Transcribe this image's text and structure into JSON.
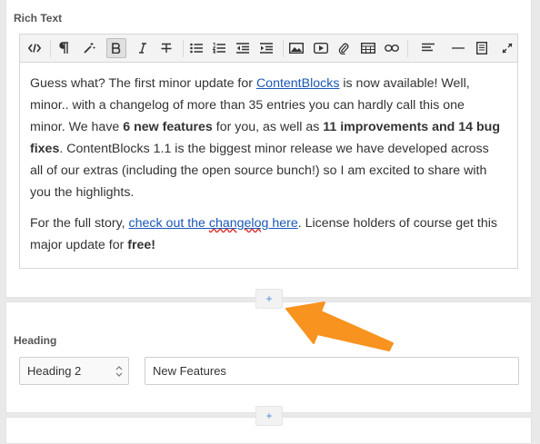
{
  "rich_text": {
    "label": "Rich Text",
    "toolbar_icons": [
      "code-view",
      "paragraph-format",
      "magic-wand",
      "bold",
      "italic",
      "strikethrough",
      "bullet-list",
      "numbered-list",
      "outdent",
      "indent",
      "image",
      "video",
      "attachment",
      "table",
      "link",
      "align",
      "horizontal-rule",
      "document",
      "fullscreen"
    ],
    "p1": {
      "t1": "Guess what? The first minor update for ",
      "link1": "ContentBlocks",
      "t2": " is now available! Well, minor.. with a changelog of more than 35 entries you can hardly call this one minor. We have ",
      "b1": "6 new features",
      "t3": " for you, as well as ",
      "b2": "11 improvements and 14 bug fixes",
      "t4": ". ContentBlocks 1.1 is the biggest minor release we have developed across all of our extras (including the open source bunch!) so I am excited to share with you the highlights."
    },
    "p2": {
      "t1": "For the full story, ",
      "link_a": "check out the ",
      "link_b": "changelog",
      "link_c": " here",
      "t2": ". License holders of course get this major update for ",
      "b1": "free!"
    }
  },
  "add_button_label": "+",
  "heading": {
    "label": "Heading",
    "level_value": "Heading 2",
    "text_value": "New Features"
  },
  "colors": {
    "link": "#1a57b8",
    "arrow": "#f7931e",
    "add_icon": "#4a8fd6"
  }
}
